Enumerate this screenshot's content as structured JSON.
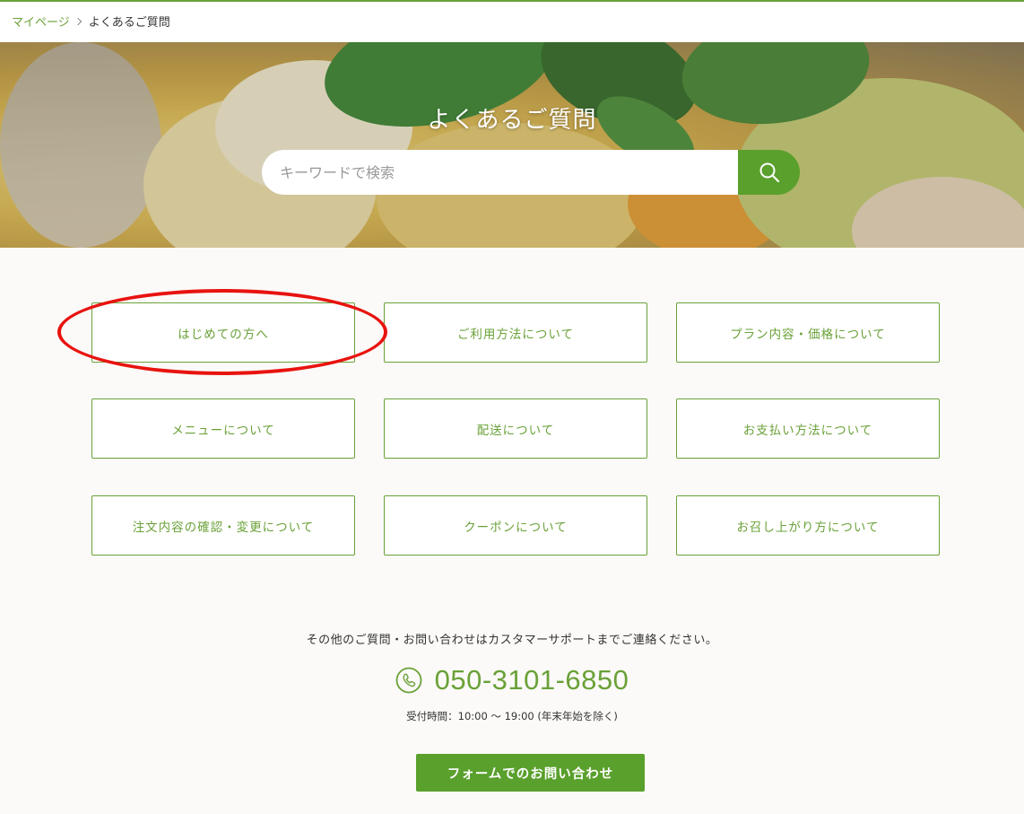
{
  "breadcrumb": {
    "items": [
      "マイページ",
      "よくあるご質問"
    ]
  },
  "hero": {
    "title": "よくあるご質問",
    "search_placeholder": "キーワードで検索",
    "search_icon": "search-icon"
  },
  "categories": [
    "はじめての方へ",
    "ご利用方法について",
    "プラン内容・価格について",
    "メニューについて",
    "配送について",
    "お支払い方法について",
    "注文内容の確認・変更について",
    "クーポンについて",
    "お召し上がり方について"
  ],
  "highlighted_category": "はじめての方へ",
  "contact": {
    "note": "その他のご質問・お問い合わせはカスタマーサポートまでご連絡ください。",
    "phone": "050-3101-6850",
    "phone_icon": "phone-icon",
    "hours": "受付時間：10:00 〜 19:00 (年末年始を除く)",
    "form_button": "フォームでのお問い合わせ"
  },
  "colors": {
    "accent": "#6aa138",
    "button": "#5aa02c",
    "highlight": "#e8130f"
  }
}
